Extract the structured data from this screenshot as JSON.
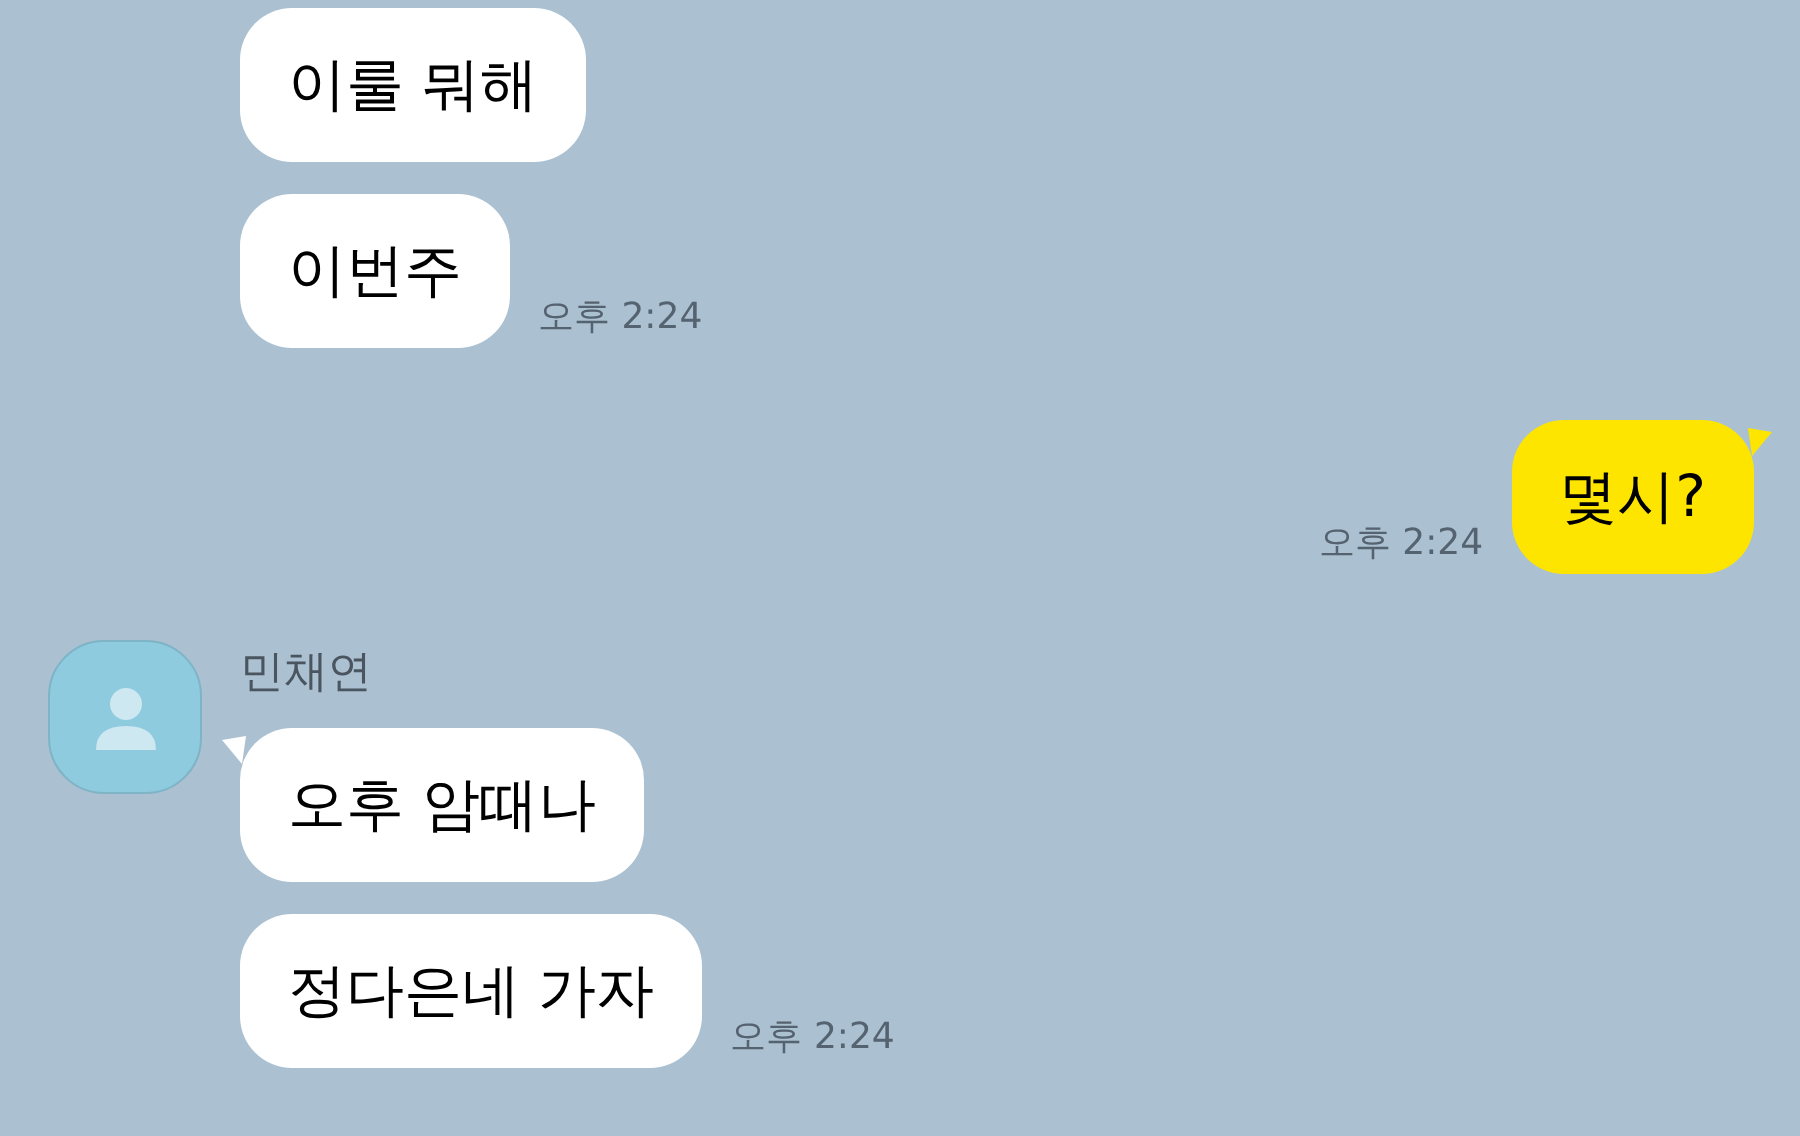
{
  "groups": [
    {
      "kind": "received",
      "messages": [
        {
          "text": "이룰 뭐해",
          "tail": false
        },
        {
          "text": "이번주",
          "tail": false
        }
      ],
      "time": "오후 2:24"
    },
    {
      "kind": "sent",
      "messages": [
        {
          "text": "몇시?",
          "tail": true
        }
      ],
      "time": "오후 2:24"
    },
    {
      "kind": "received",
      "sender": "민채연",
      "messages": [
        {
          "text": "오후 암때나",
          "tail": true
        },
        {
          "text": "정다은네 가자",
          "tail": false
        }
      ],
      "time": "오후 2:24"
    }
  ]
}
